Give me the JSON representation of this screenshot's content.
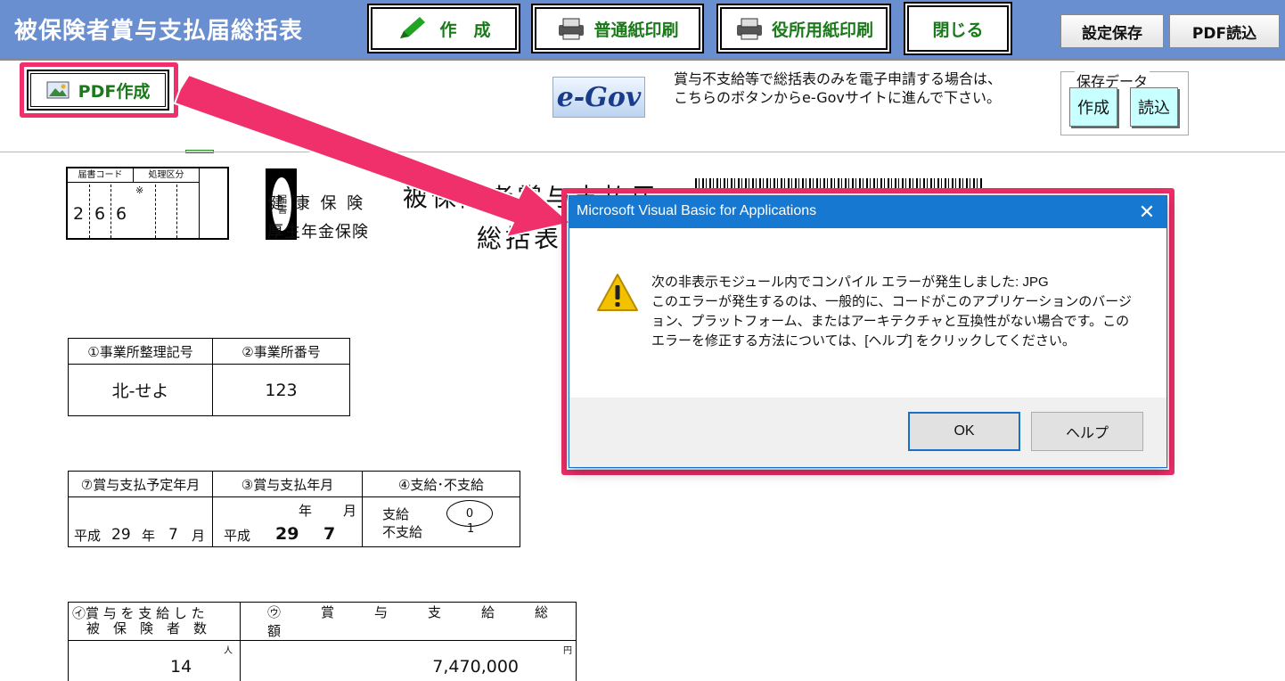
{
  "header": {
    "title": "被保険者賞与支払届総括表",
    "create_label": "作　成",
    "plain_print_label": "普通紙印刷",
    "office_print_label": "役所用紙印刷",
    "close_label": "閉じる",
    "save_settings_label": "設定保存",
    "pdf_load_label": "PDF読込"
  },
  "toolbar": {
    "pdf_create_label": "PDF作成",
    "egov_logo_text": "e-Gov",
    "egov_description": "賞与不支給等で総括表のみを電子申請する場合は、こちらのボタンからe-Govサイトに進んで下さい。",
    "saved_data_label": "保存データ",
    "saved_create_label": "作成",
    "saved_load_label": "読込"
  },
  "form": {
    "code_header": "届書コード",
    "type_header": "処理区分",
    "code_digits": [
      "2",
      "6",
      "6"
    ],
    "type_mark": "※",
    "side_label": "届書",
    "insurance_1": "健 康 保 険",
    "insurance_2": "厚生年金保険",
    "doc_title_1": "被保険者賞与支払届",
    "doc_title_2": "総括表",
    "office_ref_header": "①事業所整理記号",
    "office_num_header": "②事業所番号",
    "office_ref_value": "北-せよ",
    "office_num_value": "123",
    "planned_header": "⑦賞与支払予定年月",
    "paid_header": "③賞与支払年月",
    "payment_header": "④支給･不支給",
    "planned_era": "平成",
    "planned_year": "29",
    "planned_year_unit": "年",
    "planned_month": "7",
    "planned_month_unit": "月",
    "paid_year_unit": "年",
    "paid_month_unit": "月",
    "paid_era": "平成",
    "paid_year": "29",
    "paid_month": "7",
    "pay_label": "支給",
    "nopay_label": "不支給",
    "pay_code": "0",
    "nopay_code": "1",
    "count_header_1": "㋑賞 与 を 支 給 し た",
    "count_header_2": "被　保　険　者　数",
    "total_header": "㋒　　　賞　　　与　　　支　　　給　　　総　　　額",
    "count_unit": "人",
    "total_unit": "円",
    "count_value": "14",
    "total_value": "7,470,000"
  },
  "dialog": {
    "title": "Microsoft Visual Basic for Applications",
    "close_glyph": "✕",
    "message_line1": "次の非表示モジュール内でコンパイル エラーが発生しました: JPG",
    "message_line2": "このエラーが発生するのは、一般的に、コードがこのアプリケーションのバージョン、プラットフォーム、またはアーキテクチャと互換性がない場合です。このエラーを修正する方法については、[ヘルプ] をクリックしてください。",
    "ok_label": "OK",
    "help_label": "ヘルプ",
    "icon": "warning-icon"
  },
  "colors": {
    "header_bg": "#6a8fd0",
    "highlight": "#f0306a",
    "dialog_title_bg": "#1778d2",
    "button_text_green": "#1a7a1a"
  }
}
